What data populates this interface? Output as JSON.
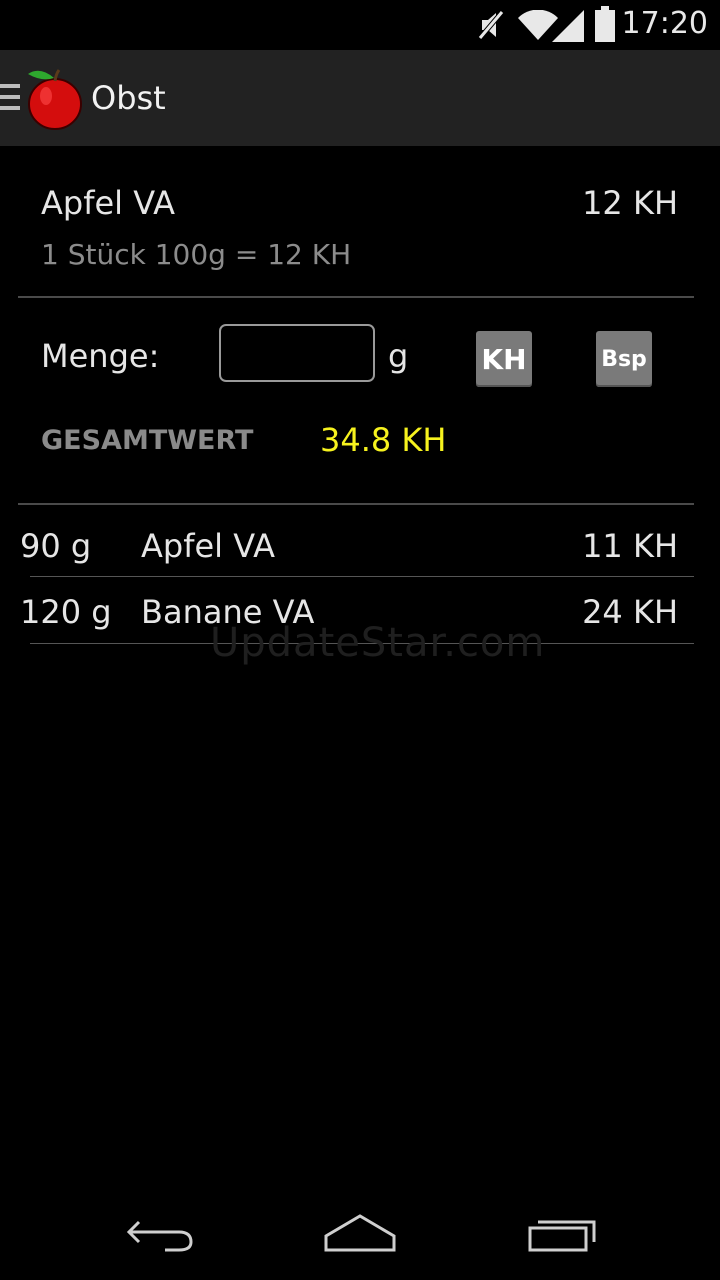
{
  "status_bar": {
    "time": "17:20",
    "icons": [
      "mute-icon",
      "wifi-icon",
      "signal-icon",
      "battery-icon"
    ]
  },
  "action_bar": {
    "title": "Obst",
    "logo": "apple-icon",
    "drawer": "drawer-menu-icon"
  },
  "food": {
    "name": "Apfel VA",
    "kh": "12 KH",
    "portion": "1 Stück 100g = 12 KH"
  },
  "amount": {
    "label": "Menge:",
    "value": "",
    "unit": "g",
    "kh_button": "KH",
    "bsp_button": "Bsp"
  },
  "total": {
    "label": "GESAMTWERT",
    "value": "34.8 KH",
    "color": "#f6f21e"
  },
  "entries": [
    {
      "amount": "90 g",
      "name": "Apfel VA",
      "kh": "11 KH"
    },
    {
      "amount": "120 g",
      "name": "Banane VA",
      "kh": "24 KH"
    }
  ],
  "watermark": "UpdateStar.com",
  "nav_bar": {
    "icons": [
      "back-icon",
      "home-icon",
      "recent-apps-icon"
    ]
  }
}
